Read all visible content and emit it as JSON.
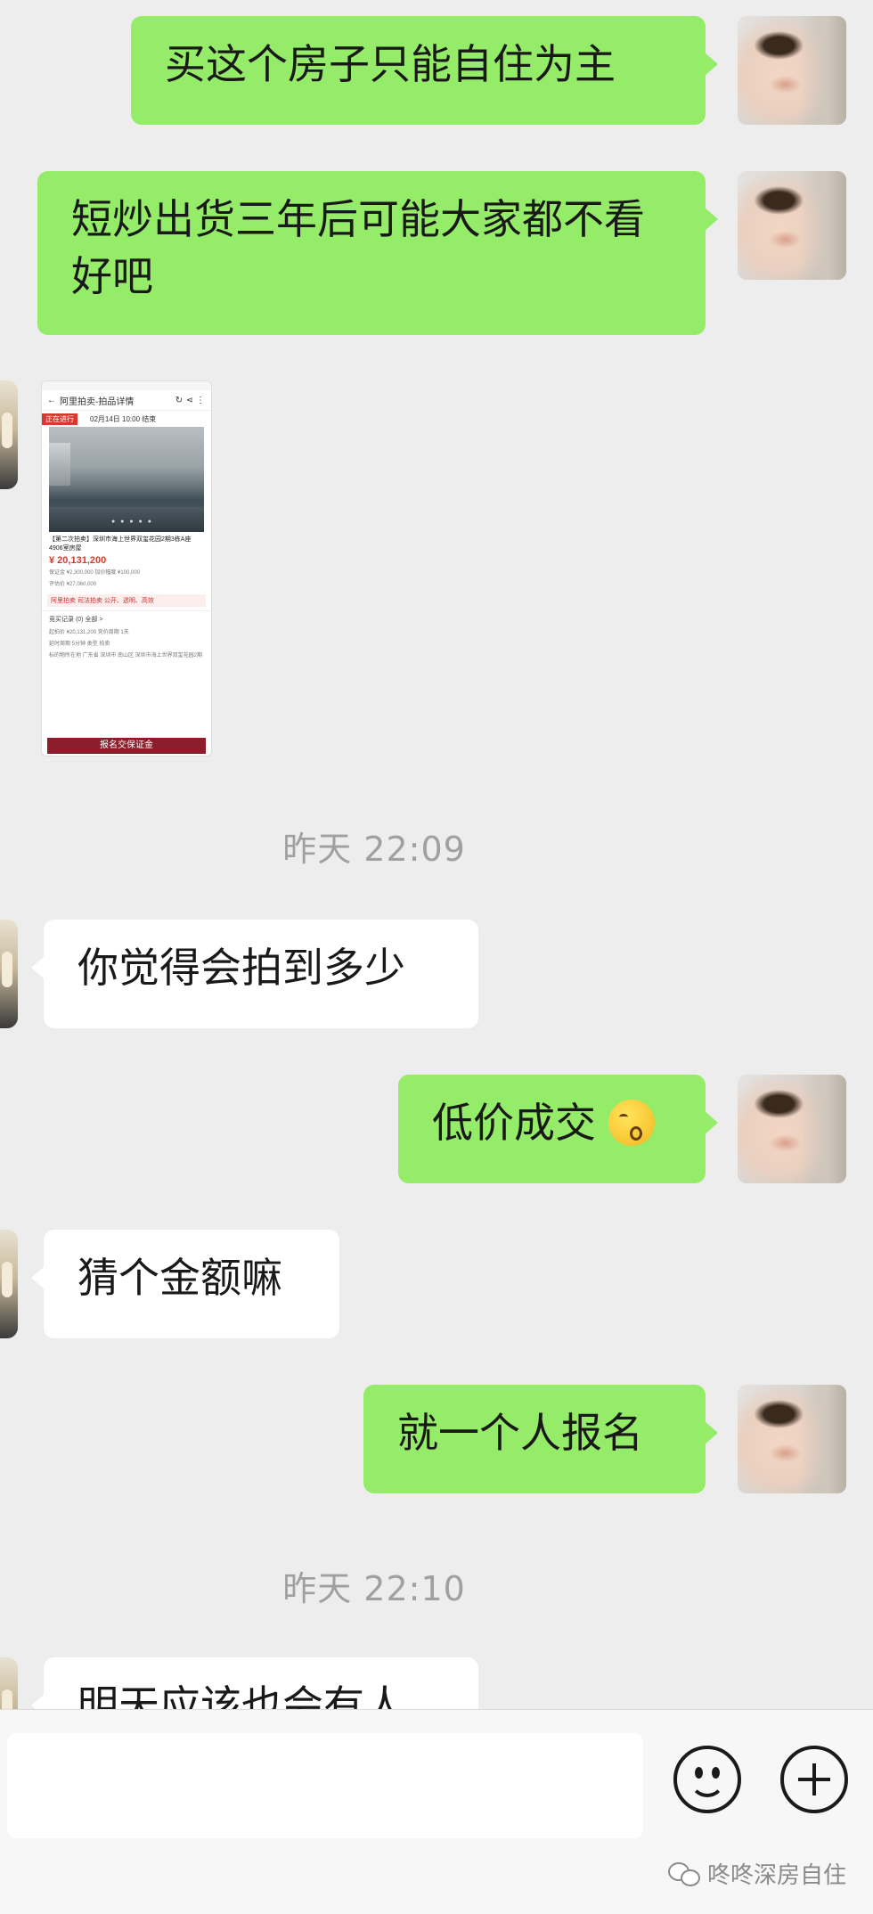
{
  "messages": [
    {
      "sender": "me",
      "text": "买这个房子只能自住为主"
    },
    {
      "sender": "me",
      "text": "短炒出货三年后可能大家都不看好吧"
    },
    {
      "sender": "other",
      "type": "image"
    },
    {
      "type": "time",
      "text": "昨天 22:09"
    },
    {
      "sender": "other",
      "text": "你觉得会拍到多少"
    },
    {
      "sender": "me",
      "text": "低价成交",
      "emoji": "kissing-face-emoji"
    },
    {
      "sender": "other",
      "text": "猜个金额嘛"
    },
    {
      "sender": "me",
      "text": "就一个人报名"
    },
    {
      "type": "time",
      "text": "昨天 22:10"
    },
    {
      "sender": "other",
      "text": "明天应该也会有人"
    }
  ],
  "shared_image": {
    "nav_title": "阿里拍卖-拍品详情",
    "status_tag": "正在进行",
    "date_text": "02月14日 10:00 结束",
    "dots": "● ● ● ● ●",
    "title": "【第二次拍卖】深圳市海上世界双玺花园2期3栋A座4906室房屋",
    "price": "¥ 20,131,200",
    "rows": [
      "保证金 ¥2,300,000    加价幅度 ¥100,000",
      "评估价 ¥27,060,000"
    ],
    "brand": "阿里拍卖 司法拍卖 公开、透明、高效",
    "record_label": "竞买记录 (0)    全部 >",
    "details": [
      "起拍价 ¥20,131,200  竞价周期 1天",
      "延时周期 5分钟  类型 拍卖"
    ],
    "location": "标的物所在地 广东省 深圳市 南山区 深圳市海上世界双玺花园2期",
    "button": "报名交保证金"
  },
  "input_bar": {
    "emoji_icon": "smiley-icon",
    "plus_icon": "plus-circle-icon"
  },
  "watermark": {
    "icon": "wechat-icon",
    "text": "咚咚深房自住"
  },
  "colors": {
    "bubble_me": "#95ec69",
    "bubble_other": "#ffffff",
    "background": "#ededed"
  }
}
